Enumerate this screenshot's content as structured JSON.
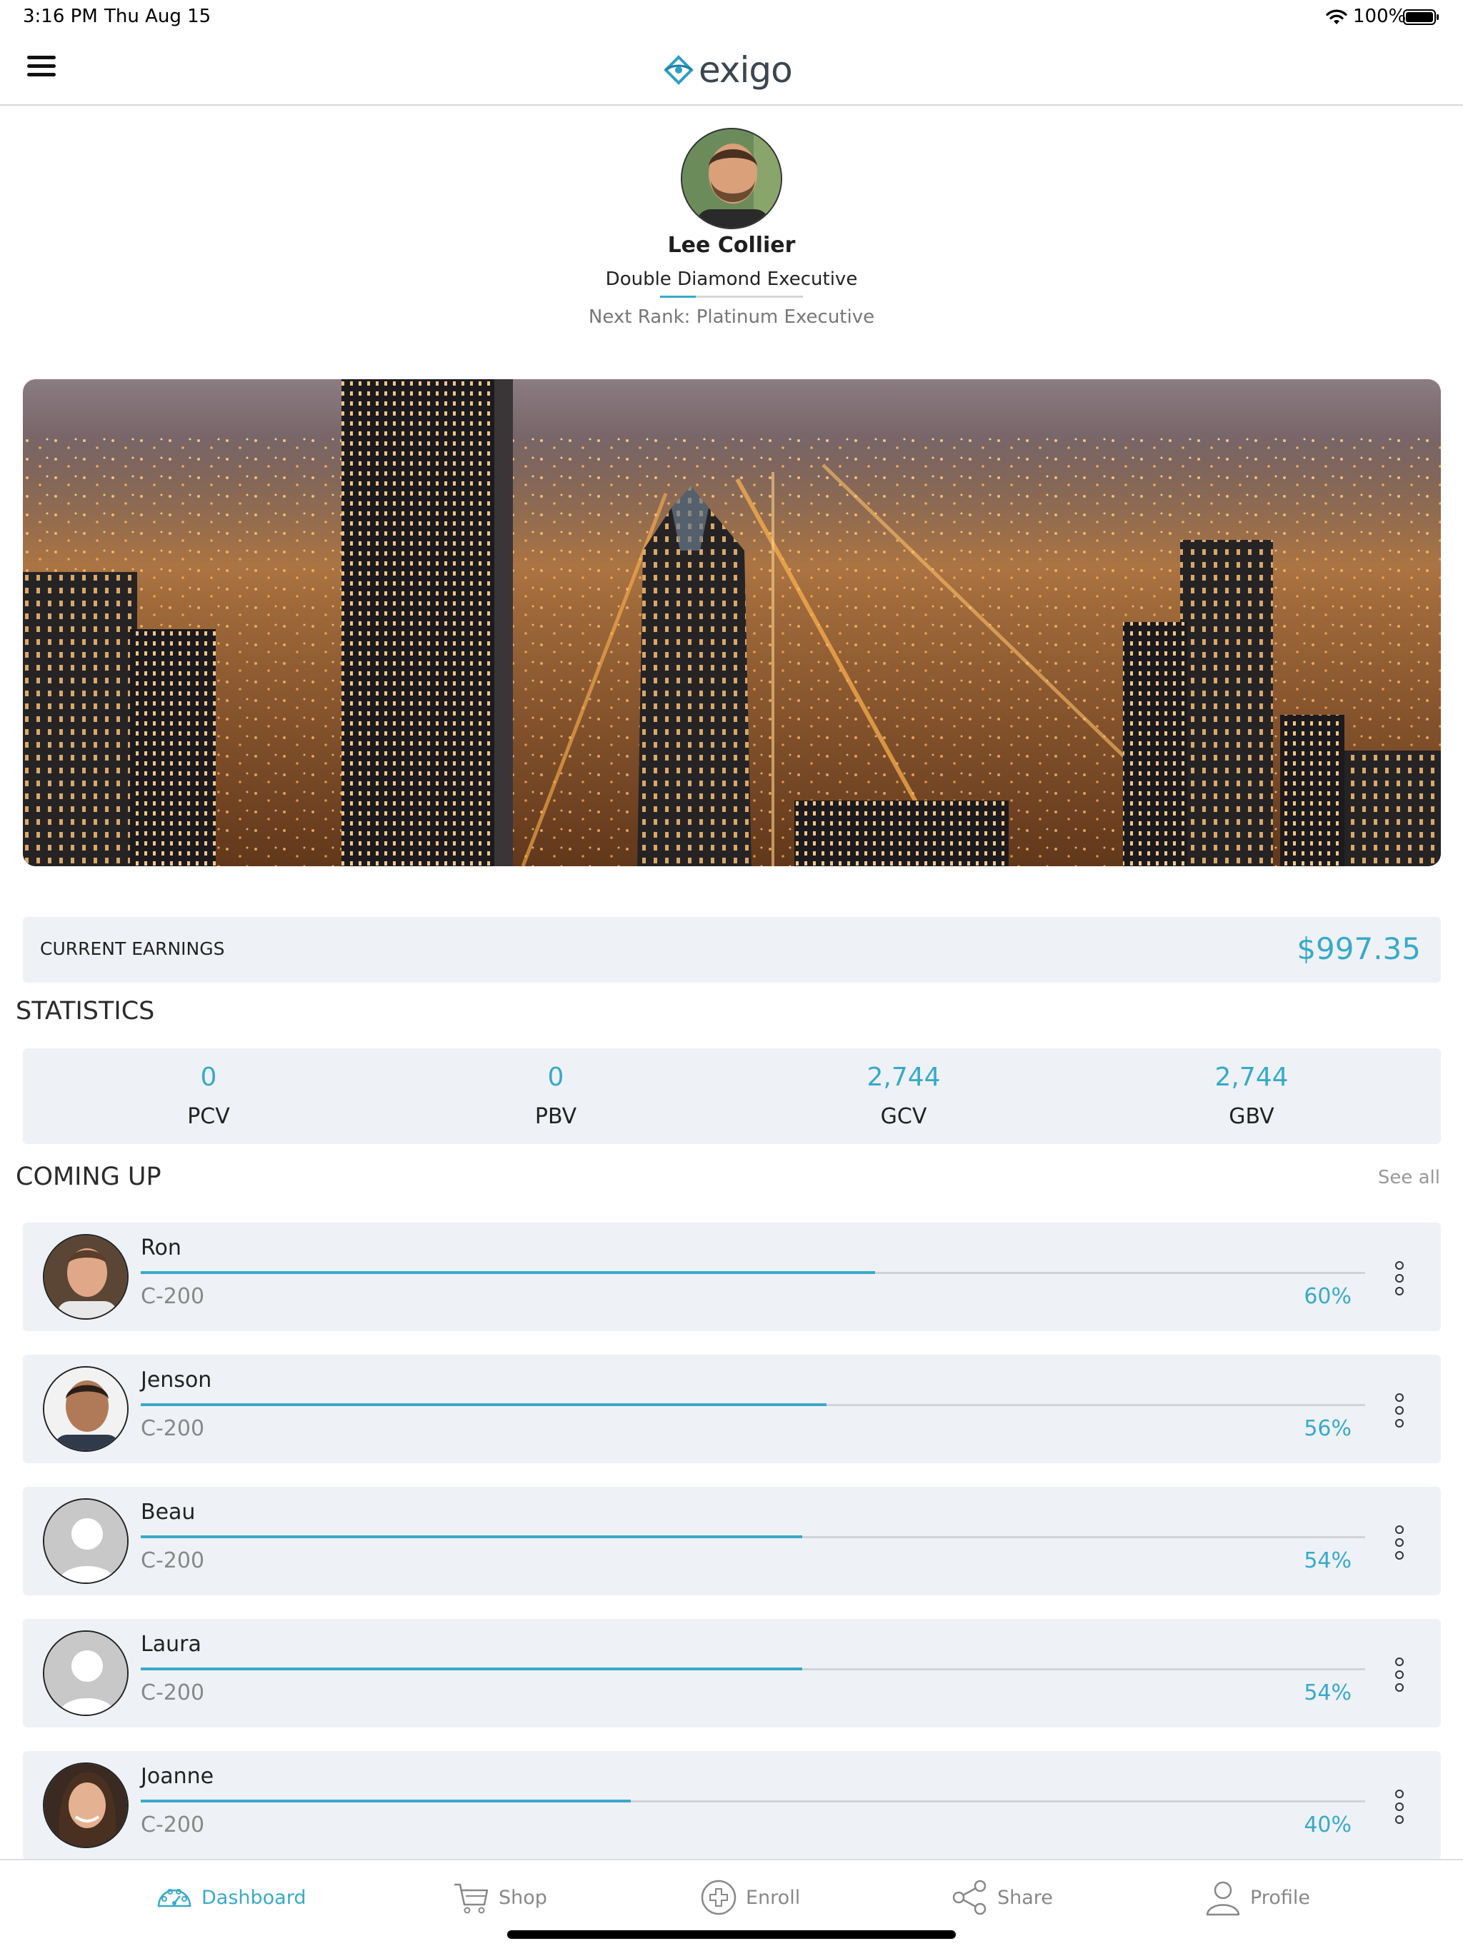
{
  "status_bar": {
    "time": "3:16 PM",
    "date": "Thu Aug 15",
    "battery": "100%"
  },
  "header": {
    "logo_text": "exigo",
    "menu_icon": "hamburger-icon"
  },
  "profile": {
    "name": "Lee Collier",
    "rank": "Double Diamond Executive",
    "rank_progress": 0.25,
    "next_rank": "Next Rank: Platinum Executive"
  },
  "earnings": {
    "label": "CURRENT EARNINGS",
    "value": "$997.35"
  },
  "statistics": {
    "title": "STATISTICS",
    "items": [
      {
        "value": "0",
        "label": "PCV"
      },
      {
        "value": "0",
        "label": "PBV"
      },
      {
        "value": "2,744",
        "label": "GCV"
      },
      {
        "value": "2,744",
        "label": "GBV"
      }
    ]
  },
  "coming_up": {
    "title": "COMING UP",
    "see_all": "See all",
    "items": [
      {
        "name": "Ron",
        "sub": "C-200",
        "pct": "60%",
        "progress": 0.6
      },
      {
        "name": "Jenson",
        "sub": "C-200",
        "pct": "56%",
        "progress": 0.56
      },
      {
        "name": "Beau",
        "sub": "C-200",
        "pct": "54%",
        "progress": 0.54
      },
      {
        "name": "Laura",
        "sub": "C-200",
        "pct": "54%",
        "progress": 0.54
      },
      {
        "name": "Joanne",
        "sub": "C-200",
        "pct": "40%",
        "progress": 0.4
      }
    ]
  },
  "tabs": [
    {
      "label": "Dashboard",
      "icon": "dashboard-icon",
      "active": true
    },
    {
      "label": "Shop",
      "icon": "cart-icon",
      "active": false
    },
    {
      "label": "Enroll",
      "icon": "plus-circle-icon",
      "active": false
    },
    {
      "label": "Share",
      "icon": "share-icon",
      "active": false
    },
    {
      "label": "Profile",
      "icon": "user-icon",
      "active": false
    }
  ],
  "colors": {
    "accent": "#3aa9c9",
    "card_bg": "#eef2f6",
    "muted": "#888888"
  }
}
